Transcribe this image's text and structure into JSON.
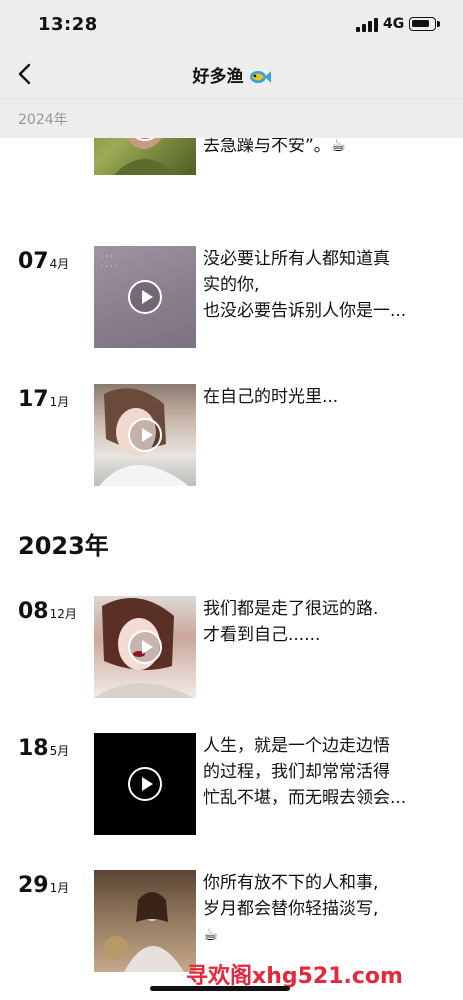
{
  "status_bar": {
    "time": "13:28",
    "network": "4G"
  },
  "nav": {
    "title": "好多渔"
  },
  "sticky_year": "2024年",
  "year_2023": "2023年",
  "entries": [
    {
      "day": "",
      "month": "",
      "caption": [
        "去急躁与不安”。☕"
      ]
    },
    {
      "day": "07",
      "month": "4月",
      "caption": [
        "没必要让所有人都知道真",
        "实的你,",
        "也没必要告诉别人你是一..."
      ]
    },
    {
      "day": "17",
      "month": "1月",
      "caption": [
        "在自己的时光里..."
      ]
    },
    {
      "day": "08",
      "month": "12月",
      "caption": [
        "我们都是走了很远的路.",
        "才看到自己......"
      ]
    },
    {
      "day": "18",
      "month": "5月",
      "caption": [
        "人生，就是一个边走边悟",
        "的过程，我们却常常活得",
        "忙乱不堪，而无暇去领会..."
      ]
    },
    {
      "day": "29",
      "month": "1月",
      "caption": [
        "你所有放不下的人和事,",
        "岁月都会替你轻描淡写,",
        "☕"
      ]
    }
  ],
  "watermark": "寻欢阁xhg521.com",
  "icons": {
    "back": "chevron-left-icon",
    "title_emoji": "fish-icon",
    "play": "play-icon"
  }
}
